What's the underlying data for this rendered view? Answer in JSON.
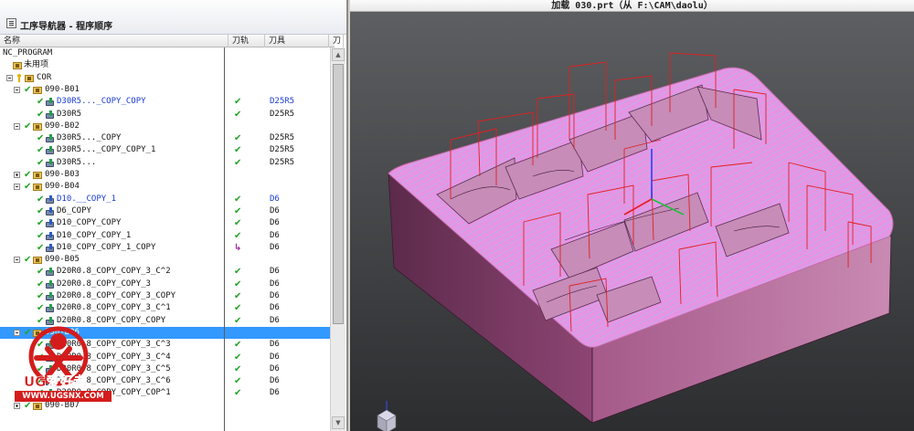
{
  "navigator": {
    "title": "工序导航器 - 程序顺序",
    "columns": {
      "name": "名称",
      "toolpath": "刀轨",
      "tool": "刀具",
      "extra": "刀"
    },
    "rows": [
      {
        "level": 0,
        "label": "NC_PROGRAM",
        "kind": "root"
      },
      {
        "level": 1,
        "label": "未用项",
        "kind": "folder"
      },
      {
        "level": 1,
        "label": "COR",
        "kind": "root-group",
        "expand": "minus"
      },
      {
        "level": 2,
        "label": "090-B01",
        "kind": "group",
        "expand": "minus"
      },
      {
        "level": 3,
        "label": "D30R5..._COPY_COPY",
        "kind": "op",
        "tp": "✔",
        "tool": "D25R5",
        "blue": true
      },
      {
        "level": 3,
        "label": "D30R5",
        "kind": "op",
        "tp": "✔",
        "tool": "D25R5"
      },
      {
        "level": 2,
        "label": "090-B02",
        "kind": "group",
        "expand": "minus"
      },
      {
        "level": 3,
        "label": "D30R5..._COPY",
        "kind": "op",
        "tp": "✔",
        "tool": "D25R5"
      },
      {
        "level": 3,
        "label": "D30R5..._COPY_COPY_1",
        "kind": "op",
        "tp": "✔",
        "tool": "D25R5"
      },
      {
        "level": 3,
        "label": "D30R5...",
        "kind": "op",
        "tp": "✔",
        "tool": "D25R5"
      },
      {
        "level": 2,
        "label": "090-B03",
        "kind": "group",
        "expand": "plus"
      },
      {
        "level": 2,
        "label": "090-B04",
        "kind": "group",
        "expand": "minus"
      },
      {
        "level": 3,
        "label": "D10.__COPY_1",
        "kind": "op2",
        "tp": "✔",
        "tool": "D6",
        "blue": true
      },
      {
        "level": 3,
        "label": "D6_COPY",
        "kind": "op2",
        "tp": "✔",
        "tool": "D6"
      },
      {
        "level": 3,
        "label": "D10_COPY_COPY",
        "kind": "op2",
        "tp": "✔",
        "tool": "D6"
      },
      {
        "level": 3,
        "label": "D10_COPY_COPY_1",
        "kind": "op2",
        "tp": "✔",
        "tool": "D6"
      },
      {
        "level": 3,
        "label": "D10_COPY_COPY_1_COPY",
        "kind": "op2",
        "tp": "↳",
        "tool": "D6",
        "replay": true
      },
      {
        "level": 2,
        "label": "090-B05",
        "kind": "group",
        "expand": "minus"
      },
      {
        "level": 3,
        "label": "D20R0.8_COPY_COPY_3_C^2",
        "kind": "op",
        "tp": "✔",
        "tool": "D6"
      },
      {
        "level": 3,
        "label": "D20R0.8_COPY_COPY_3",
        "kind": "op",
        "tp": "✔",
        "tool": "D6"
      },
      {
        "level": 3,
        "label": "D20R0.8_COPY_COPY_3_COPY",
        "kind": "op",
        "tp": "✔",
        "tool": "D6"
      },
      {
        "level": 3,
        "label": "D20R0.8_COPY_COPY_3_C^1",
        "kind": "op",
        "tp": "✔",
        "tool": "D6"
      },
      {
        "level": 3,
        "label": "D20R0.8_COPY_COPY_COPY",
        "kind": "op",
        "tp": "✔",
        "tool": "D6"
      },
      {
        "level": 2,
        "label": "090-B06",
        "kind": "group",
        "expand": "minus",
        "selected": true
      },
      {
        "level": 3,
        "label": "D20R0.8_COPY_COPY_3_C^3",
        "kind": "op",
        "tp": "✔",
        "tool": "D6"
      },
      {
        "level": 3,
        "label": "D20R0.8_COPY_COPY_3_C^4",
        "kind": "op",
        "tp": "✔",
        "tool": "D6"
      },
      {
        "level": 3,
        "label": "D20R0.8_COPY_COPY_3_C^5",
        "kind": "op",
        "tp": "✔",
        "tool": "D6"
      },
      {
        "level": 3,
        "label": "D20R0.8_COPY_COPY_3_C^6",
        "kind": "op",
        "tp": "✔",
        "tool": "D6"
      },
      {
        "level": 3,
        "label": "D20R0.8_COPY_COPY_COP^1",
        "kind": "op",
        "tp": "✔",
        "tool": "D6"
      },
      {
        "level": 2,
        "label": "090-B07",
        "kind": "group",
        "expand": "plus"
      }
    ]
  },
  "graphics": {
    "title": "加载 030.prt（从 F:\\CAM\\daolu）"
  },
  "watermark": {
    "brand": "UG爱好者",
    "url": "WWW.UGSNX.COM"
  },
  "colors": {
    "selection": "#3399ff",
    "check": "#22a422",
    "part_top": "#e89be8",
    "part_side": "#8a3f6e",
    "toolpath": "#e02020"
  }
}
